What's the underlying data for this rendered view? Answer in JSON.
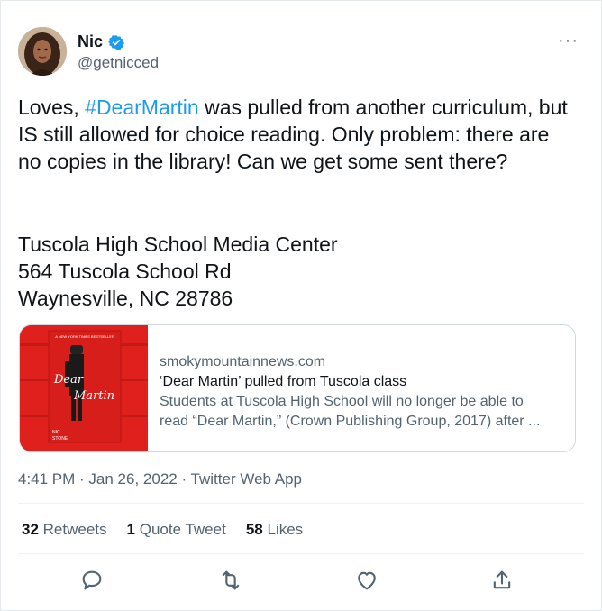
{
  "author": {
    "name": "Nic",
    "handle": "@getnicced",
    "verified": true,
    "avatar_icon": "avatar-photo"
  },
  "tweet": {
    "text_before": "Loves, ",
    "hashtag": "#DearMartin",
    "text_after": " was pulled from another curriculum, but IS still allowed for choice reading. Only problem: there are no copies in the library! Can we get some sent there?",
    "address_lines": [
      "Tuscola High School Media Center",
      "564 Tuscola School Rd",
      "Waynesville, NC 28786"
    ]
  },
  "link_card": {
    "domain": "smokymountainnews.com",
    "title": "‘Dear Martin’ pulled from Tuscola class",
    "description_line1": "Students at Tuscola High School will no longer be able to",
    "description_line2": "read “Dear Martin,” (Crown Publishing Group, 2017) after ...",
    "thumbnail": {
      "banner": "A NEW YORK TIMES BESTSELLER",
      "title_word1": "Dear",
      "title_word2": "Martin",
      "author_line1": "NIC",
      "author_line2": "STONE"
    }
  },
  "meta": {
    "time": "4:41 PM",
    "separator1": " · ",
    "date": "Jan 26, 2022",
    "separator2": " · ",
    "source": "Twitter Web App"
  },
  "stats": {
    "retweets_count": "32",
    "retweets_label": "Retweets",
    "quotes_count": "1",
    "quotes_label": "Quote Tweet",
    "likes_count": "58",
    "likes_label": "Likes"
  },
  "more_label": "···",
  "icons": {
    "verified": "verified-badge-icon",
    "reply": "reply-icon",
    "retweet": "retweet-icon",
    "like": "heart-icon",
    "share": "share-icon"
  },
  "colors": {
    "accent": "#1d9bf0",
    "text": "#0f1419",
    "secondary": "#536471",
    "border": "#cfd9de",
    "thumbnail_red": "#e0201c"
  }
}
